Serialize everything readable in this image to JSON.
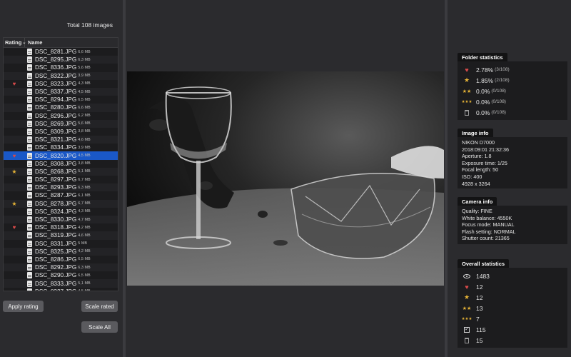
{
  "left": {
    "total_label": "Total 108 images",
    "col_rating": "Rating",
    "col_name": "Name",
    "files": [
      {
        "name": "DSC_8281.JPG",
        "size": "6,6 MB",
        "rating": ""
      },
      {
        "name": "DSC_8295.JPG",
        "size": "6,3 MB",
        "rating": ""
      },
      {
        "name": "DSC_8336.JPG",
        "size": "5,6 MB",
        "rating": ""
      },
      {
        "name": "DSC_8322.JPG",
        "size": "3,9 MB",
        "rating": ""
      },
      {
        "name": "DSC_8323.JPG",
        "size": "4,3 MB",
        "rating": "heart"
      },
      {
        "name": "DSC_8337.JPG",
        "size": "4,5 MB",
        "rating": ""
      },
      {
        "name": "DSC_8294.JPG",
        "size": "6,5 MB",
        "rating": ""
      },
      {
        "name": "DSC_8280.JPG",
        "size": "6,6 MB",
        "rating": ""
      },
      {
        "name": "DSC_8296.JPG",
        "size": "6,2 MB",
        "rating": ""
      },
      {
        "name": "DSC_8269.JPG",
        "size": "5,6 MB",
        "rating": ""
      },
      {
        "name": "DSC_8309.JPG",
        "size": "3,8 MB",
        "rating": ""
      },
      {
        "name": "DSC_8321.JPG",
        "size": "4,6 MB",
        "rating": ""
      },
      {
        "name": "DSC_8334.JPG",
        "size": "3,9 MB",
        "rating": ""
      },
      {
        "name": "DSC_8320.JPG",
        "size": "4,5 MB",
        "rating": "heart",
        "selected": true
      },
      {
        "name": "DSC_8308.JPG",
        "size": "3,8 MB",
        "rating": ""
      },
      {
        "name": "DSC_8268.JPG",
        "size": "5,1 MB",
        "rating": "star"
      },
      {
        "name": "DSC_8297.JPG",
        "size": "6,7 MB",
        "rating": ""
      },
      {
        "name": "DSC_8293.JPG",
        "size": "6,3 MB",
        "rating": ""
      },
      {
        "name": "DSC_8287.JPG",
        "size": "6,1 MB",
        "rating": ""
      },
      {
        "name": "DSC_8278.JPG",
        "size": "6,7 MB",
        "rating": "star"
      },
      {
        "name": "DSC_8324.JPG",
        "size": "4,3 MB",
        "rating": ""
      },
      {
        "name": "DSC_8330.JPG",
        "size": "4,7 MB",
        "rating": ""
      },
      {
        "name": "DSC_8318.JPG",
        "size": "4,2 MB",
        "rating": "heart"
      },
      {
        "name": "DSC_8319.JPG",
        "size": "4,6 MB",
        "rating": ""
      },
      {
        "name": "DSC_8331.JPG",
        "size": "5 MB",
        "rating": ""
      },
      {
        "name": "DSC_8325.JPG",
        "size": "4,2 MB",
        "rating": ""
      },
      {
        "name": "DSC_8286.JPG",
        "size": "6,5 MB",
        "rating": ""
      },
      {
        "name": "DSC_8292.JPG",
        "size": "6,3 MB",
        "rating": ""
      },
      {
        "name": "DSC_8290.JPG",
        "size": "6,5 MB",
        "rating": ""
      },
      {
        "name": "DSC_8333.JPG",
        "size": "5,1 MB",
        "rating": ""
      },
      {
        "name": "DSC_8327.JPG",
        "size": "4,5 MB",
        "rating": ""
      }
    ],
    "apply_rating_label": "Apply rating",
    "scale_rated_label": "Scale rated",
    "scale_all_label": "Scale All"
  },
  "right": {
    "folder_title": "Folder statistics",
    "folder_stats": [
      {
        "icon": "heart-icon",
        "value": "2.78%",
        "sub": "(3/108)"
      },
      {
        "icon": "star-1-icon",
        "value": "1.85%",
        "sub": "(2/108)"
      },
      {
        "icon": "star-2-icon",
        "value": "0.0%",
        "sub": "(0/108)"
      },
      {
        "icon": "star-3-icon",
        "value": "0.0%",
        "sub": "(0/108)"
      },
      {
        "icon": "trash-icon",
        "value": "0.0%",
        "sub": "(0/108)"
      }
    ],
    "image_title": "Image info",
    "image_info": [
      "NIKON D7000",
      "2018:09:01 21:32:36",
      "Aperture: 1.8",
      "Exposure time: 1/25",
      "Focal length: 50",
      "ISO: 400",
      "4928 x 3264"
    ],
    "camera_title": "Camera info",
    "camera_info": [
      "Quality: FINE",
      "White balance: 4550K",
      "Focus mode: MANUAL",
      "Flash setting: NORMAL",
      "Shutter count: 21365"
    ],
    "overall_title": "Overall statistics",
    "overall_stats": [
      {
        "icon": "eye-icon",
        "value": "1483"
      },
      {
        "icon": "heart-icon",
        "value": "12"
      },
      {
        "icon": "star-1-icon",
        "value": "12"
      },
      {
        "icon": "star-2-icon",
        "value": "13"
      },
      {
        "icon": "star-3-icon",
        "value": "7"
      },
      {
        "icon": "checkbox-icon",
        "value": "115"
      },
      {
        "icon": "trash-icon",
        "value": "15"
      }
    ]
  },
  "colors": {
    "selection": "#1a58c7",
    "heart": "#d84a4a",
    "star": "#e7b436"
  }
}
